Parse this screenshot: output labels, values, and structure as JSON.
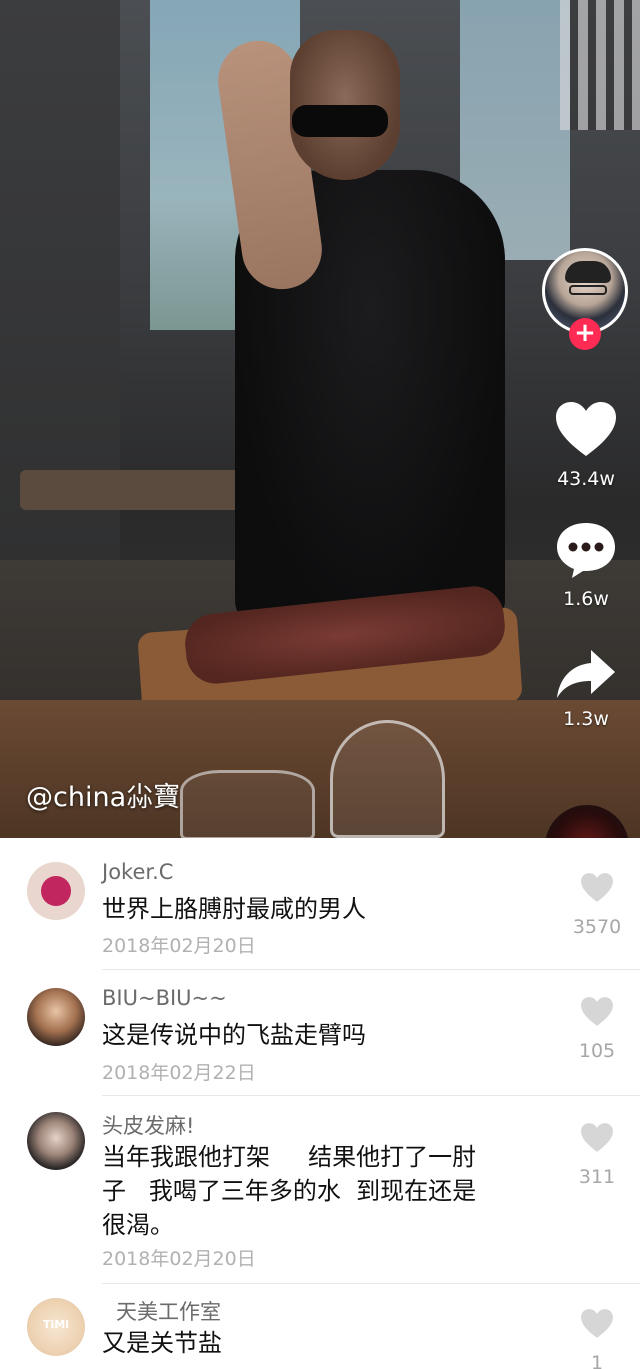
{
  "video": {
    "watermark": "@china尛寶",
    "actions": {
      "likes": "43.4w",
      "comments": "1.6w",
      "shares": "1.3w"
    }
  },
  "comments": [
    {
      "name": "Joker.C",
      "text": "世界上胳膊肘最咸的男人",
      "date": "2018年02月20日",
      "likes": "3570"
    },
    {
      "name": "BIU~BIU~~",
      "text": "这是传说中的飞盐走臂吗",
      "date": "2018年02月22日",
      "likes": "105"
    },
    {
      "name": "头皮发麻!",
      "text_lines": [
        "当年我跟他打架     结果他打了一肘",
        "子   我喝了三年多的水  到现在还是",
        "很渴。"
      ],
      "date": "2018年02月20日",
      "likes": "311"
    },
    {
      "name": "天美工作室",
      "text": "又是关节盐",
      "avatar_text": "TiMi",
      "likes": "1"
    }
  ],
  "colors": {
    "follow": "#ff2b54",
    "name": "#6b6b6b",
    "date": "#b1b1b1"
  }
}
